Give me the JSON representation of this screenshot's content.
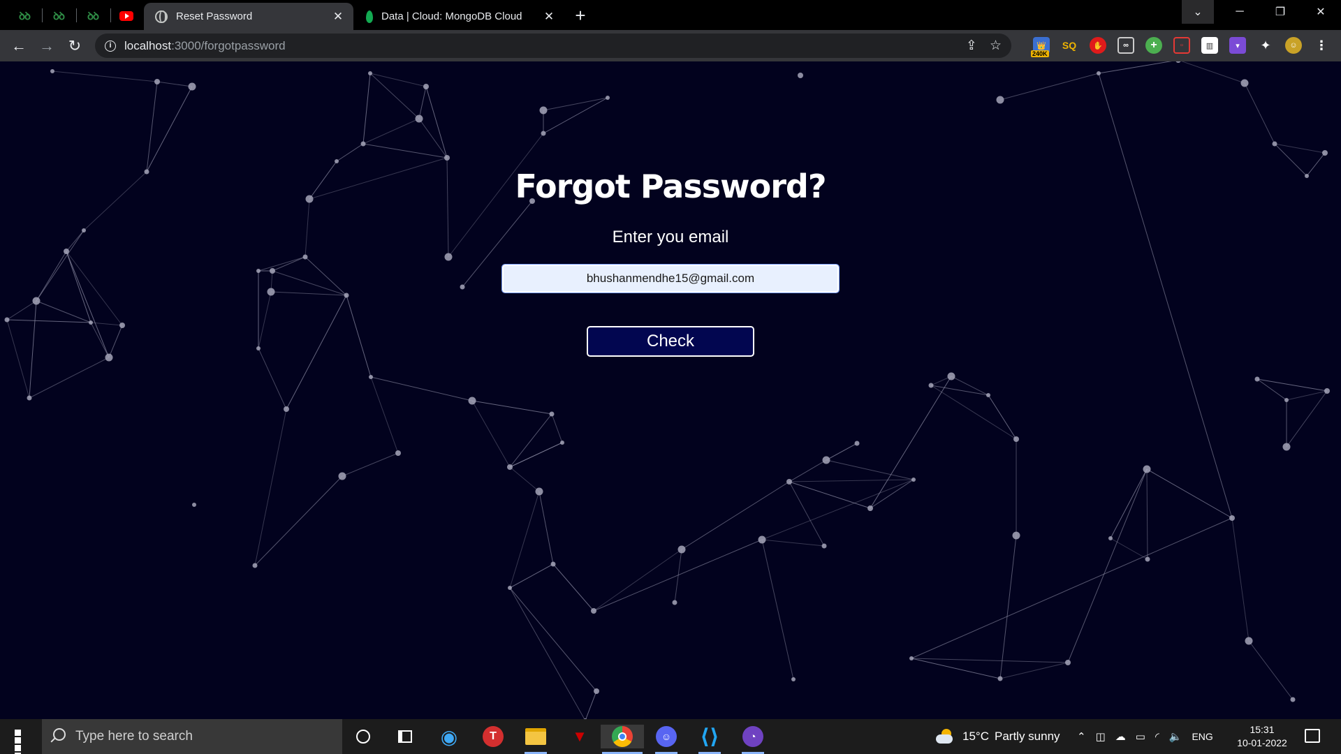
{
  "browser": {
    "pinned_tabs": [
      {
        "icon": "geeksforgeeks-icon",
        "glyph": "ꝺꝺ"
      },
      {
        "icon": "geeksforgeeks-icon",
        "glyph": "ꝺꝺ"
      },
      {
        "icon": "geeksforgeeks-icon",
        "glyph": "ꝺꝺ"
      },
      {
        "icon": "youtube-icon",
        "glyph": ""
      }
    ],
    "tabs": [
      {
        "title": "Reset Password",
        "icon": "globe-icon",
        "active": true
      },
      {
        "title": "Data | Cloud: MongoDB Cloud",
        "icon": "mongodb-leaf-icon",
        "active": false
      }
    ],
    "url": {
      "host": "localhost",
      "path": ":3000/forgotpassword"
    },
    "extension_badge": "240K",
    "colors": {
      "chrome_bg": "#000000",
      "toolbar": "#35363a",
      "omnibox": "#202124"
    }
  },
  "page": {
    "title": "Forgot Password?",
    "subtitle": "Enter you email",
    "email_value": "bhushanmendhe15@gmail.com",
    "check_label": "Check",
    "colors": {
      "background": "#02021e",
      "button": "#020650",
      "network": "#9a9ab0"
    }
  },
  "taskbar": {
    "search_placeholder": "Type here to search",
    "weather": {
      "temp": "15°C",
      "condition": "Partly sunny"
    },
    "language": "ENG",
    "time": "15:31",
    "date": "10-01-2022"
  }
}
